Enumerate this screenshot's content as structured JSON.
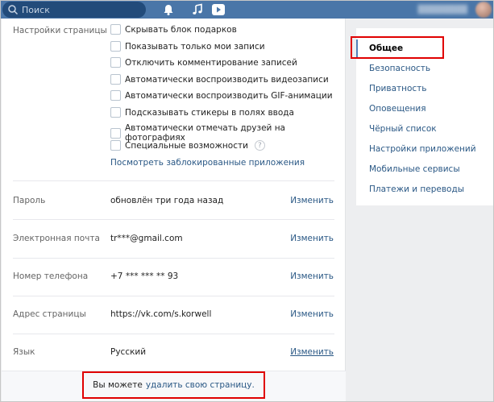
{
  "header": {
    "search_placeholder": "Поиск"
  },
  "settings": {
    "page_settings_label": "Настройки страницы",
    "checkboxes": [
      "Скрывать блок подарков",
      "Показывать только мои записи",
      "Отключить комментирование записей",
      "Автоматически воспроизводить видеозаписи",
      "Автоматически воспроизводить GIF-анимации",
      "Подсказывать стикеры в полях ввода",
      "Автоматически отмечать друзей на фотографиях",
      "Специальные возможности"
    ],
    "help_mark": "?",
    "blocked_apps_link": "Посмотреть заблокированные приложения",
    "rows": [
      {
        "label": "Пароль",
        "value": "обновлён три года назад",
        "action": "Изменить"
      },
      {
        "label": "Электронная почта",
        "value": "tr***@gmail.com",
        "action": "Изменить"
      },
      {
        "label": "Номер телефона",
        "value": "+7 *** *** ** 93",
        "action": "Изменить"
      },
      {
        "label": "Адрес страницы",
        "value": "https://vk.com/s.korwell",
        "action": "Изменить"
      },
      {
        "label": "Язык",
        "value": "Русский",
        "action": "Изменить"
      }
    ],
    "delete_text": "Вы можете",
    "delete_link": "удалить свою страницу."
  },
  "menu": {
    "items": [
      "Общее",
      "Безопасность",
      "Приватность",
      "Оповещения",
      "Чёрный список",
      "Настройки приложений",
      "Мобильные сервисы",
      "Платежи и переводы"
    ]
  },
  "colors": {
    "header": "#4a76a8",
    "link": "#2a5885",
    "highlight": "#e00000"
  }
}
